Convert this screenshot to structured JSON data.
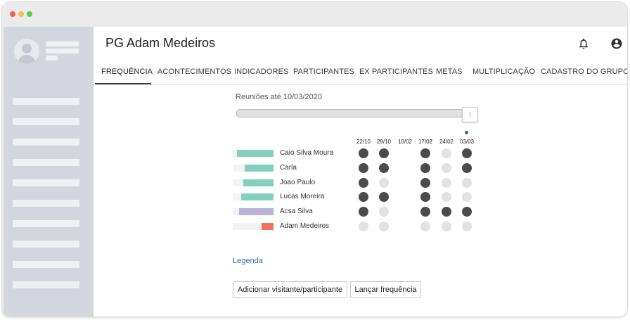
{
  "page": {
    "title": "PG Adam Medeiros"
  },
  "tabs": [
    {
      "label": "FREQUÊNCIA",
      "active": true
    },
    {
      "label": "ACONTECIMENTOS"
    },
    {
      "label": "INDICADORES"
    },
    {
      "label": "PARTICIPANTES"
    },
    {
      "label": "EX PARTICIPANTES"
    },
    {
      "label": "METAS"
    },
    {
      "label": "MULTIPLICAÇÃO"
    },
    {
      "label": "CADASTRO DO GRUPO"
    }
  ],
  "attendance": {
    "range_label": "Reuniões até 10/03/2020",
    "slider_value_fraction": 1.0,
    "dates": [
      "22/10",
      "29/10",
      "10/02",
      "17/02",
      "24/02",
      "03/03"
    ],
    "current_date": "03/03",
    "participants": [
      {
        "name": "Caio Silva Moura",
        "frequency": 0.9,
        "color": "#84d0bf",
        "presence": [
          1,
          1,
          null,
          1,
          0,
          1
        ]
      },
      {
        "name": "Carla",
        "frequency": 0.7,
        "color": "#84d0bf",
        "presence": [
          1,
          1,
          null,
          1,
          0,
          1
        ]
      },
      {
        "name": "Joao Paulo",
        "frequency": 0.75,
        "color": "#84d0bf",
        "presence": [
          1,
          0,
          null,
          1,
          0,
          0
        ]
      },
      {
        "name": "Lucas Moreira",
        "frequency": 0.8,
        "color": "#84d0bf",
        "presence": [
          1,
          1,
          null,
          1,
          0,
          0
        ]
      },
      {
        "name": "Acsa Silva",
        "frequency": 0.85,
        "color": "#b9b3d9",
        "presence": [
          1,
          0,
          null,
          1,
          1,
          1
        ]
      },
      {
        "name": "Adam Medeiros",
        "frequency": 0.3,
        "color": "#f27060",
        "presence": [
          0,
          0,
          null,
          0,
          0,
          0
        ]
      }
    ]
  },
  "legend_link": "Legenda",
  "buttons": {
    "add_visitor": "Adicionar visitante/participante",
    "launch_frequency": "Lançar frequência"
  },
  "icons": {
    "notifications": "bell-icon",
    "account": "account-circle-icon",
    "avatar": "user-avatar-icon"
  },
  "colors": {
    "window_close": "#f2605a",
    "window_minimize": "#f5be4f",
    "window_maximize": "#5fc94e",
    "present": "#4b4b4b",
    "absent": "#e2e2e2",
    "link": "#2e6da4",
    "sidebar": "#d3d6dd"
  }
}
